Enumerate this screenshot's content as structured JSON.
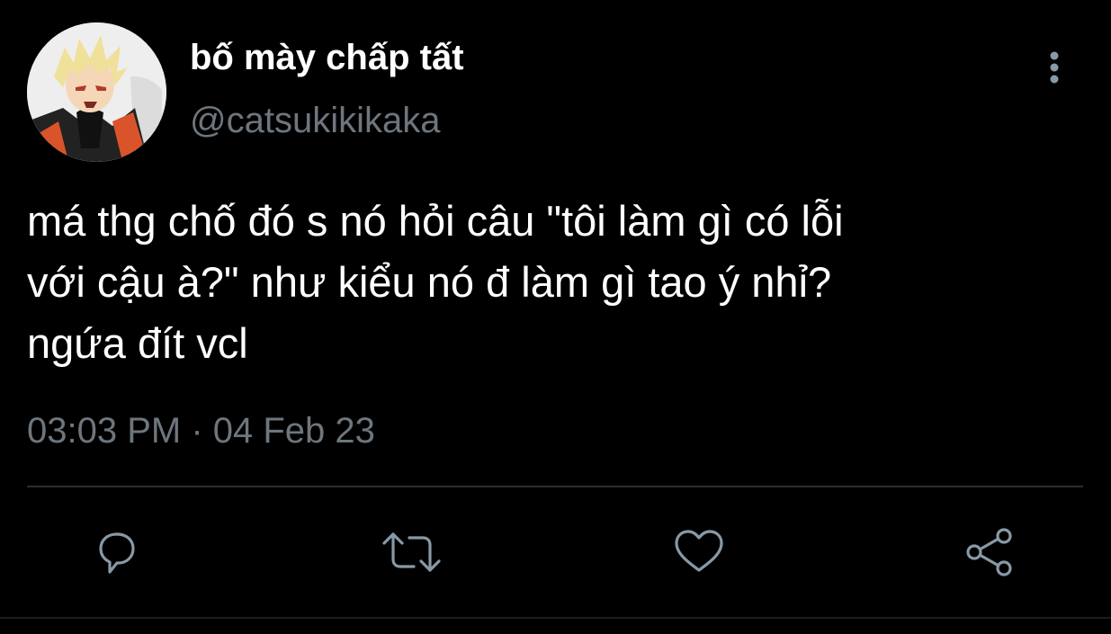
{
  "author": {
    "display_name": "bố mày chấp tất",
    "handle": "@catsukikikaka",
    "avatar_icon": "avatar-image"
  },
  "tweet": {
    "text": "má thg chố đó s nó hỏi câu \"tôi làm gì có lỗi\nvới cậu à?\" như kiểu nó đ làm gì tao ý nhỉ?\nngứa đít vcl",
    "timestamp": "03:03 PM · 04 Feb 23"
  },
  "actions": {
    "reply_icon": "reply-icon",
    "retweet_icon": "retweet-icon",
    "like_icon": "heart-icon",
    "share_icon": "share-icon",
    "more_icon": "more-vertical-icon"
  },
  "colors": {
    "background": "#000000",
    "primary_text": "#ffffff",
    "secondary_text": "#6e767d",
    "icon": "#8899a6",
    "divider": "#2a2d30"
  }
}
